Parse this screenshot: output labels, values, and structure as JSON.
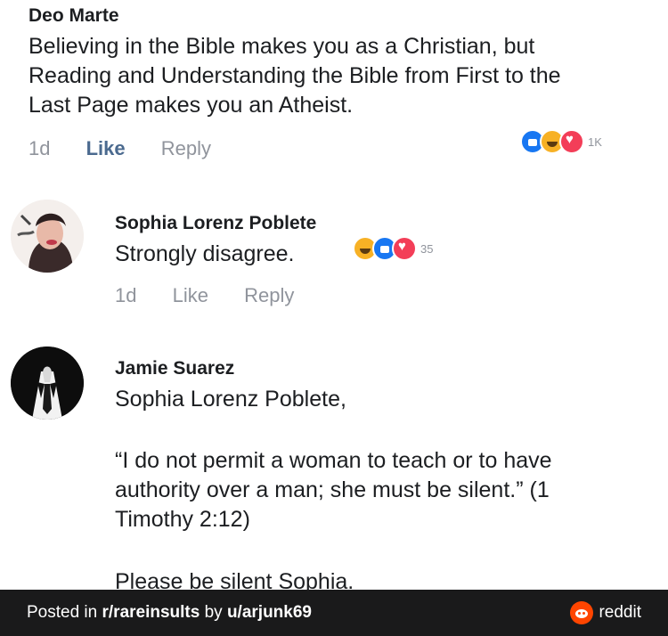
{
  "comment1": {
    "author": "Deo Marte",
    "lines": [
      "Believing in the Bible makes you as a Christian, but",
      "Reading and Understanding the Bible from First to the",
      "Last Page makes you an Atheist."
    ],
    "time": "1d",
    "like_label": "Like",
    "reply_label": "Reply",
    "reaction_count": "1K",
    "reaction_icons": [
      "like-icon",
      "haha-icon",
      "love-icon"
    ]
  },
  "comment2": {
    "author": "Sophia Lorenz Poblete",
    "text": "Strongly disagree.",
    "time": "1d",
    "like_label": "Like",
    "reply_label": "Reply",
    "reaction_count": "35",
    "reaction_icons": [
      "haha-icon",
      "like-icon",
      "love-icon"
    ]
  },
  "comment3": {
    "author": "Jamie Suarez",
    "mention": "Sophia Lorenz Poblete,",
    "quote_lines": [
      "“I do not permit a woman to teach or to have",
      "authority over a man; she must be silent.” (1",
      "Timothy 2:12)"
    ],
    "closing": "Please be silent Sophia."
  },
  "footer": {
    "posted_in": "Posted in ",
    "subreddit": "r/rareinsults",
    "by": " by ",
    "user": "u/arjunk69",
    "brand": "reddit"
  },
  "colors": {
    "footer_bg": "#1a1a1b",
    "reddit_orange": "#ff4500",
    "like_blue": "#1877f2",
    "meta_gray": "#90949c"
  }
}
